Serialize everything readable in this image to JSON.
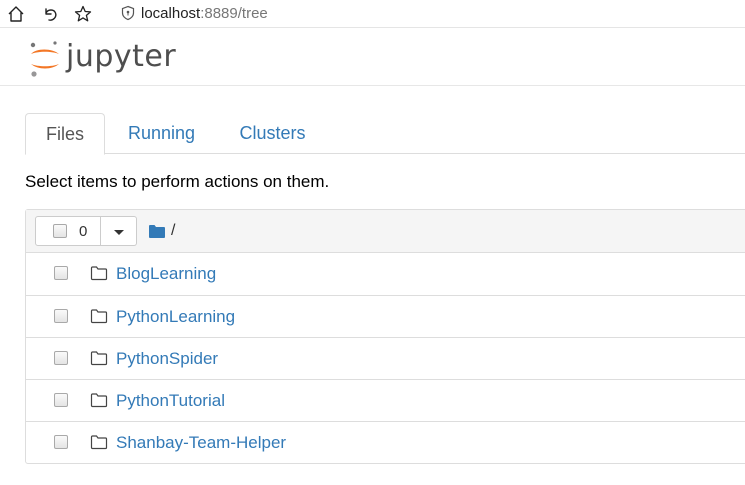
{
  "browser": {
    "url_host": "localhost",
    "url_rest": ":8889/tree"
  },
  "header": {
    "logo_text": "jupyter"
  },
  "tabs": [
    {
      "label": "Files",
      "active": true
    },
    {
      "label": "Running",
      "active": false
    },
    {
      "label": "Clusters",
      "active": false
    }
  ],
  "instructions": "Select items to perform actions on them.",
  "list": {
    "selected_count": "0",
    "breadcrumb": "/",
    "items": [
      {
        "name": "BlogLearning",
        "icon": "folder-icon"
      },
      {
        "name": "PythonLearning",
        "icon": "folder-icon"
      },
      {
        "name": "PythonSpider",
        "icon": "folder-icon"
      },
      {
        "name": "PythonTutorial",
        "icon": "folder-icon"
      },
      {
        "name": "Shanbay-Team-Helper",
        "icon": "folder-icon"
      }
    ]
  },
  "colors": {
    "link": "#337ab7",
    "logo_orange": "#f37726",
    "logo_text": "#4e4e4e"
  }
}
